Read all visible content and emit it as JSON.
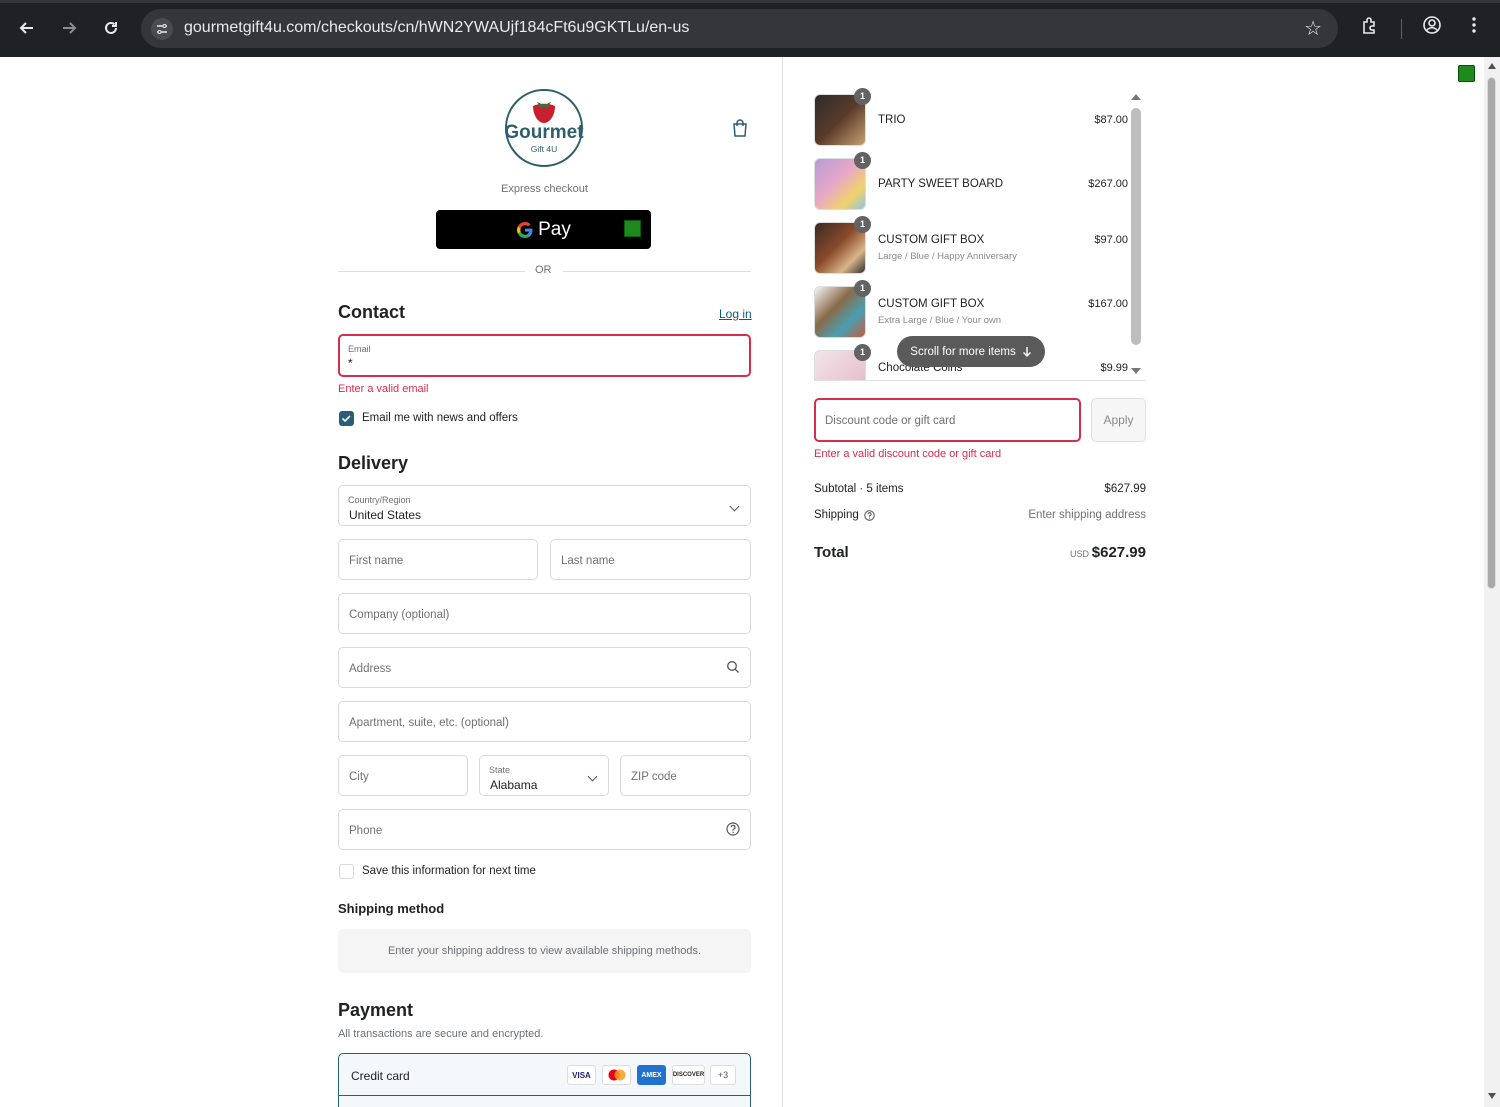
{
  "browser": {
    "url": "gourmetgift4u.com/checkouts/cn/hWN2YWAUjf184cFt6u9GKTLu/en-us"
  },
  "brand": {
    "logo_text": "Gourmet",
    "logo_subtext": "Gift 4U",
    "accent": "#d72c4d",
    "primary": "#2a5d78"
  },
  "express": {
    "label": "Express checkout",
    "gpay_label": "Pay",
    "or": "OR"
  },
  "contact": {
    "title": "Contact",
    "login": "Log in",
    "email_label": "Email",
    "email_value": "*",
    "email_error": "Enter a valid email",
    "newsletter_label": "Email me with news and offers",
    "newsletter_checked": true
  },
  "delivery": {
    "title": "Delivery",
    "country_label": "Country/Region",
    "country_value": "United States",
    "first_name": "First name",
    "last_name": "Last name",
    "company": "Company (optional)",
    "address": "Address",
    "apartment": "Apartment, suite, etc. (optional)",
    "city": "City",
    "state_label": "State",
    "state_value": "Alabama",
    "zip": "ZIP code",
    "phone": "Phone",
    "save_info": "Save this information for next time",
    "save_checked": false
  },
  "shipping_method": {
    "title": "Shipping method",
    "note": "Enter your shipping address to view available shipping methods."
  },
  "payment": {
    "title": "Payment",
    "subtitle": "All transactions are secure and encrypted.",
    "method": "Credit card",
    "cards": [
      "VISA",
      "mastercard",
      "AMEX",
      "DISCOVER"
    ],
    "more_cards": "+3"
  },
  "cart": {
    "items": [
      {
        "qty": "1",
        "name": "TRIO",
        "variant": "",
        "price": "$87.00"
      },
      {
        "qty": "1",
        "name": "PARTY SWEET BOARD",
        "variant": "",
        "price": "$267.00"
      },
      {
        "qty": "1",
        "name": "CUSTOM GIFT BOX",
        "variant": "Large / Blue / Happy Anniversary",
        "price": "$97.00"
      },
      {
        "qty": "1",
        "name": "CUSTOM GIFT BOX",
        "variant": "Extra Large / Blue / Your own",
        "price": "$167.00"
      },
      {
        "qty": "1",
        "name": "Chocolate Coins",
        "variant": "",
        "price": "$9.99"
      }
    ],
    "scroll_hint": "Scroll for more items",
    "discount_placeholder": "Discount code or gift card",
    "apply": "Apply",
    "discount_error": "Enter a valid discount code or gift card",
    "subtotal_label": "Subtotal · 5 items",
    "subtotal_value": "$627.99",
    "shipping_label": "Shipping",
    "shipping_value": "Enter shipping address",
    "total_label": "Total",
    "currency": "USD",
    "total_value": "$627.99"
  }
}
